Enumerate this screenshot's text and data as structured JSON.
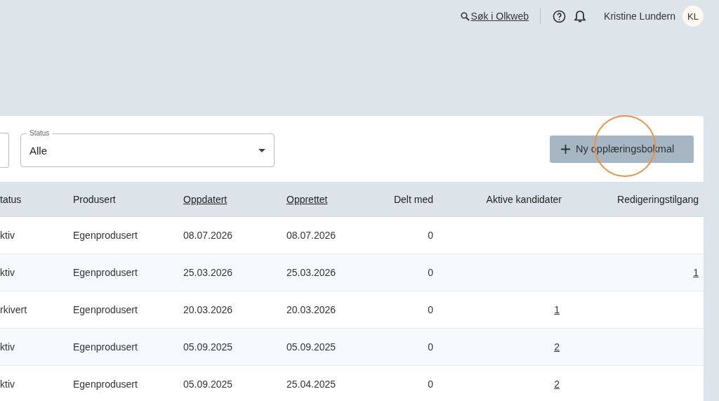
{
  "topbar": {
    "search_link": "Søk i Olkweb",
    "user_name": "Kristine Lundern",
    "avatar_initials": "KL"
  },
  "filters": {
    "status": {
      "label": "Status",
      "value": "Alle"
    }
  },
  "new_button": {
    "label": "Ny opplæringsbokmal",
    "click_highlight": true
  },
  "table": {
    "columns": [
      {
        "label": "tatus",
        "sortable": false
      },
      {
        "label": "Produsert",
        "sortable": false
      },
      {
        "label": "Oppdatert",
        "sortable": true
      },
      {
        "label": "Opprettet",
        "sortable": true
      },
      {
        "label": "Delt med",
        "sortable": false
      },
      {
        "label": "Aktive kandidater",
        "sortable": false
      },
      {
        "label": "Redigeringstilgang",
        "sortable": false
      }
    ],
    "rows": [
      {
        "cells": [
          {
            "text": "ktiv"
          },
          {
            "text": "Egenprodusert"
          },
          {
            "text": "08.07.2026"
          },
          {
            "text": "08.07.2026"
          },
          {
            "text": "0"
          },
          null,
          null
        ]
      },
      {
        "cells": [
          {
            "text": "ktiv"
          },
          {
            "text": "Egenprodusert"
          },
          {
            "text": "25.03.2026"
          },
          {
            "text": "25.03.2026"
          },
          {
            "text": "0"
          },
          null,
          {
            "text": "1",
            "link": true
          }
        ]
      },
      {
        "cells": [
          {
            "text": "rkivert"
          },
          {
            "text": "Egenprodusert"
          },
          {
            "text": "20.03.2026"
          },
          {
            "text": "20.03.2026"
          },
          {
            "text": "0"
          },
          {
            "text": "1",
            "link": true
          },
          null
        ]
      },
      {
        "cells": [
          {
            "text": "ktiv"
          },
          {
            "text": "Egenprodusert"
          },
          {
            "text": "05.09.2025"
          },
          {
            "text": "05.09.2025"
          },
          {
            "text": "0"
          },
          {
            "text": "2",
            "link": true
          },
          null
        ]
      },
      {
        "cells": [
          {
            "text": "ktiv"
          },
          {
            "text": "Egenprodusert"
          },
          {
            "text": "05.09.2025"
          },
          {
            "text": "25.04.2025"
          },
          {
            "text": "0"
          },
          {
            "text": "2",
            "link": true
          },
          null
        ]
      }
    ]
  }
}
